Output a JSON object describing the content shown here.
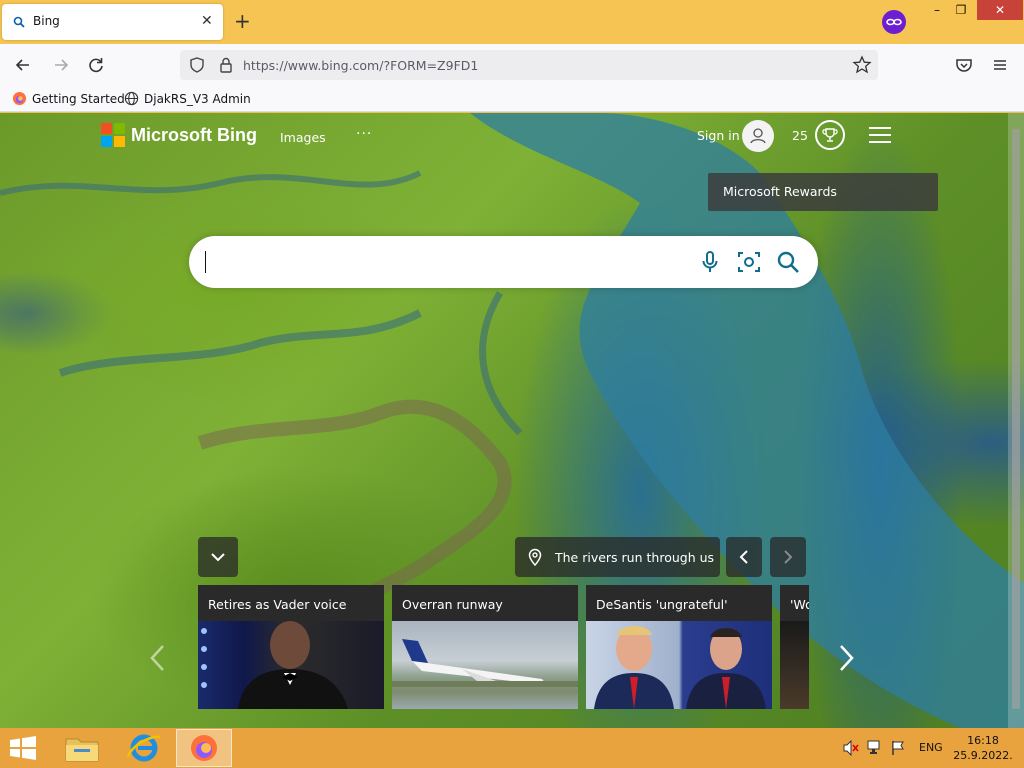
{
  "browser": {
    "tab": {
      "title": "Bing",
      "close_label": "✕"
    },
    "new_tab_label": "+",
    "window_controls": {
      "minimize": "–",
      "maximize": "❐",
      "close": "✕"
    },
    "address": {
      "url": "https://www.bing.com/?FORM=Z9FD1"
    },
    "bookmarks": [
      {
        "label": "Getting Started",
        "icon": "firefox-icon"
      },
      {
        "label": "DjakRS_V3 Admin",
        "icon": "globe-icon"
      }
    ]
  },
  "bing": {
    "brand": "Microsoft Bing",
    "nav": {
      "images": "Images",
      "more": "···"
    },
    "header": {
      "sign_in": "Sign in",
      "points": "25",
      "rewards_tooltip": "Microsoft Rewards"
    },
    "search": {
      "value": "",
      "placeholder": ""
    },
    "location_caption": "The rivers run through us",
    "cards": [
      {
        "title": "Retires as Vader voice"
      },
      {
        "title": "Overran runway"
      },
      {
        "title": "DeSantis 'ungrateful'"
      },
      {
        "title": "'Wo"
      }
    ]
  },
  "taskbar": {
    "apps": [
      "file-explorer-icon",
      "internet-explorer-icon",
      "firefox-icon"
    ],
    "language": "ENG",
    "time": "16:18",
    "date": "25.9.2022."
  },
  "colors": {
    "titlebar": "#f6c453",
    "taskbar": "#e8a33e",
    "close_button": "#c7433a",
    "private_badge": "#6b1fd1",
    "bing_accent": "#0e6e8c"
  }
}
